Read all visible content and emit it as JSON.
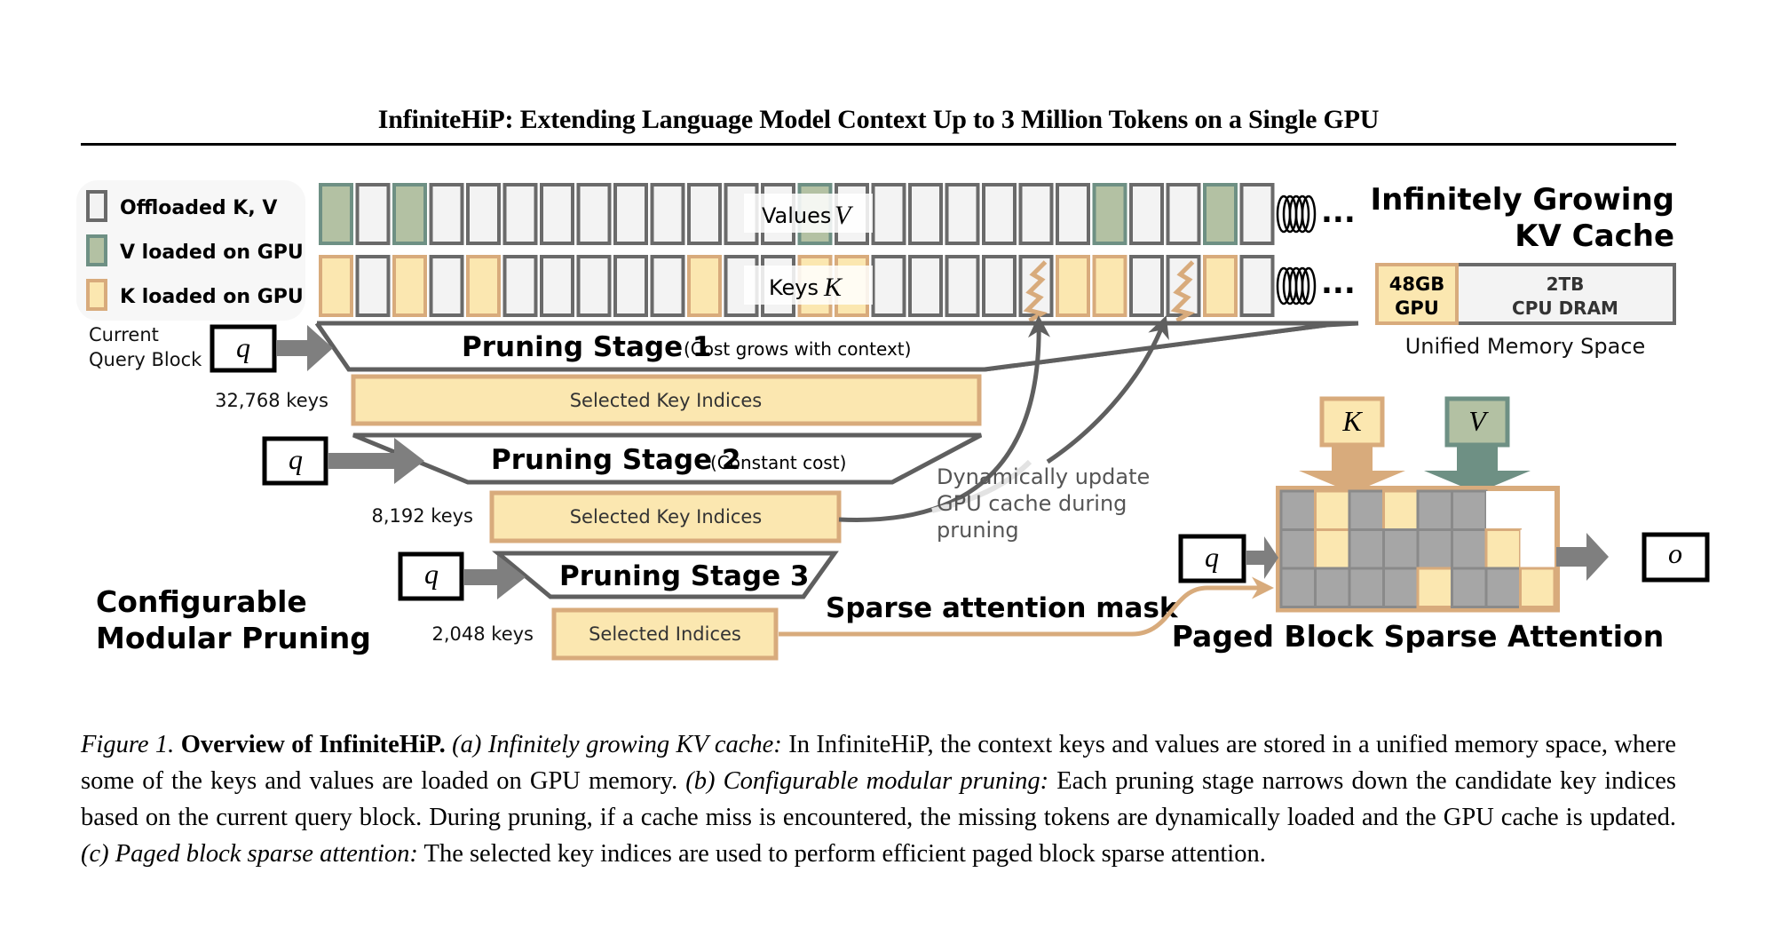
{
  "header": {
    "running_title": "InfiniteHiP: Extending Language Model Context Up to 3 Million Tokens on a Single GPU"
  },
  "colors": {
    "offloaded_fill": "#f3f3f3",
    "offloaded_stroke": "#6a6a6a",
    "v_fill": "#b3c1a3",
    "v_stroke": "#6e9084",
    "k_fill": "#fbe7b0",
    "k_stroke": "#d8ab7c",
    "arrow_gray": "#7f7f7f",
    "dark_gray": "#5f5f5f",
    "mask_gray": "#a6a6a6",
    "v_arrow": "#6e9084",
    "k_arrow": "#d8ab7c"
  },
  "legend": {
    "items": [
      {
        "label": "Offloaded K, V",
        "kind": "offloaded"
      },
      {
        "label": "V loaded on GPU",
        "kind": "v"
      },
      {
        "label": "K loaded on GPU",
        "kind": "k"
      }
    ]
  },
  "kv_cache": {
    "values_label": "Values",
    "values_symbol": "V",
    "keys_label": "Keys",
    "keys_symbol": "K",
    "values_row": [
      "v",
      "o",
      "v",
      "o",
      "o",
      "o",
      "o",
      "o",
      "o",
      "o",
      "o",
      "o",
      "o",
      "v",
      "o",
      "o",
      "o",
      "o",
      "o",
      "o",
      "o",
      "v",
      "o",
      "o",
      "v",
      "o"
    ],
    "keys_row": [
      "k",
      "o",
      "k",
      "o",
      "k",
      "o",
      "o",
      "o",
      "o",
      "o",
      "k",
      "o",
      "o",
      "k",
      "k",
      "o",
      "o",
      "o",
      "o",
      "z",
      "k",
      "k",
      "o",
      "z",
      "k",
      "o"
    ],
    "ellipsis": "...",
    "title_line1": "Infinitely Growing",
    "title_line2": "KV Cache",
    "memory": {
      "gpu_size": "48GB",
      "gpu_label": "GPU",
      "cpu_size": "2TB",
      "cpu_label": "CPU DRAM",
      "caption": "Unified Memory Space"
    }
  },
  "pruning": {
    "current_query_line1": "Current",
    "current_query_line2": "Query Block",
    "q_symbol": "q",
    "stage1": {
      "title": "Pruning Stage 1",
      "note": "(Cost grows with context)",
      "keys": "32,768 keys",
      "output": "Selected Key Indices"
    },
    "stage2": {
      "title": "Pruning Stage 2",
      "note": "(Constant cost)",
      "keys": "8,192 keys",
      "output": "Selected Key Indices"
    },
    "stage3": {
      "title": "Pruning Stage 3",
      "note": "",
      "keys": "2,048 keys",
      "output": "Selected Indices"
    },
    "section_title_line1": "Configurable",
    "section_title_line2": "Modular Pruning",
    "update_note_line1": "Dynamically update",
    "update_note_line2": "GPU cache during",
    "update_note_line3": "pruning",
    "mask_label": "Sparse attention mask"
  },
  "attention": {
    "k_symbol": "K",
    "v_symbol": "V",
    "q_symbol": "q",
    "o_symbol": "o",
    "title": "Paged Block Sparse Attention",
    "mask": [
      [
        "g",
        "k",
        "g",
        "k",
        "g",
        "g",
        "w",
        "w"
      ],
      [
        "g",
        "k",
        "g",
        "g",
        "g",
        "g",
        "k",
        "w"
      ],
      [
        "g",
        "g",
        "g",
        "g",
        "k",
        "g",
        "g",
        "k"
      ]
    ]
  },
  "caption": {
    "fig_label": "Figure 1.",
    "bold_title": "Overview of InfiniteHiP.",
    "a_label": "(a) Infinitely growing KV cache:",
    "a_text": "In InfiniteHiP, the context keys and values are stored in a unified memory space, where some of the keys and values are loaded on GPU memory.",
    "b_label": "(b) Configurable modular pruning:",
    "b_text": "Each pruning stage narrows down the candidate key indices based on the current query block. During pruning, if a cache miss is encountered, the missing tokens are dynamically loaded and the GPU cache is updated.",
    "c_label": "(c) Paged block sparse attention:",
    "c_text": "The selected key indices are used to perform efficient paged block sparse attention."
  }
}
